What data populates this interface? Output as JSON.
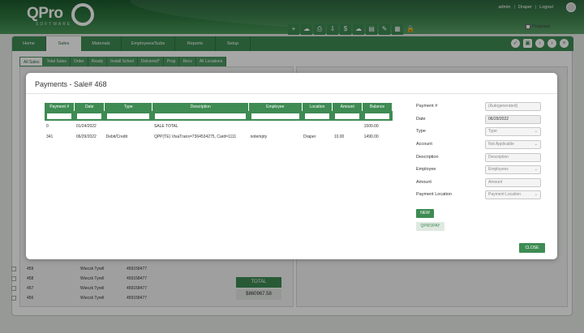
{
  "header": {
    "logo_text": "QPro",
    "logo_sub": "SOFTWARE",
    "user": "admin",
    "location": "Draper",
    "logout": "Logout",
    "sep": "|"
  },
  "nav": {
    "tabs": [
      {
        "label": "Home"
      },
      {
        "label": "Sales"
      },
      {
        "label": "Materials"
      },
      {
        "label": "Employees/Subs"
      },
      {
        "label": "Reports"
      },
      {
        "label": "Setup"
      }
    ],
    "icons": [
      "check-circle-icon",
      "save-icon",
      "prev-icon",
      "next-icon",
      "close-icon"
    ]
  },
  "subtabs": [
    {
      "label": "All Sales"
    },
    {
      "label": "Total Sales"
    },
    {
      "label": "Order"
    },
    {
      "label": "Ready"
    },
    {
      "label": "Install Sched"
    },
    {
      "label": "Delivered*"
    },
    {
      "label": "Prop"
    },
    {
      "label": "Recv"
    },
    {
      "label": "All Locations"
    }
  ],
  "proposal_label": "Proposal",
  "background_rows": [
    {
      "id": "459",
      "name": "Wieczk Tyrell",
      "phone": "459158477"
    },
    {
      "id": "458",
      "name": "Wieczk Tyrell",
      "phone": "459158477"
    },
    {
      "id": "457",
      "name": "Wieczk Tyrell",
      "phone": "459158477"
    },
    {
      "id": "456",
      "name": "Wieczk Tyrell",
      "phone": "459158477"
    }
  ],
  "total": {
    "label": "TOTAL",
    "value": "$860967.58"
  },
  "modal": {
    "title": "Payments - Sale# 468",
    "columns": [
      "Payment #",
      "Date",
      "Type",
      "Description",
      "Employee",
      "Location",
      "Amount",
      "Balance"
    ],
    "rows": [
      {
        "payment": "0",
        "date": "01/24/2022",
        "type": "",
        "description": "SALE TOTAL",
        "employee": "",
        "location": "",
        "amount": "",
        "balance": "1500.00"
      },
      {
        "payment": "341",
        "date": "06/29/2022",
        "type": "Debit/Credit",
        "description": "QPP(TE) VisaTrans=7364534275, Card=1111",
        "employee": "notempty",
        "location": "Draper",
        "amount": "10.00",
        "balance": "1490.00"
      }
    ],
    "form": {
      "payment_no_label": "Payment #",
      "payment_no_value": "(Autogenerated)",
      "date_label": "Date",
      "date_value": "06/29/2022",
      "type_label": "Type",
      "type_value": "Type",
      "account_label": "Account",
      "account_value": "Not Applicable",
      "description_label": "Description",
      "description_placeholder": "Description",
      "employee_label": "Employee",
      "employee_value": "Employees",
      "amount_label": "Amount",
      "amount_placeholder": "Amount",
      "location_label": "Payment Location",
      "location_value": "Payment Location"
    },
    "new_label": "NEW",
    "qpropay_label": "QPROPAY",
    "close_label": "CLOSE"
  }
}
